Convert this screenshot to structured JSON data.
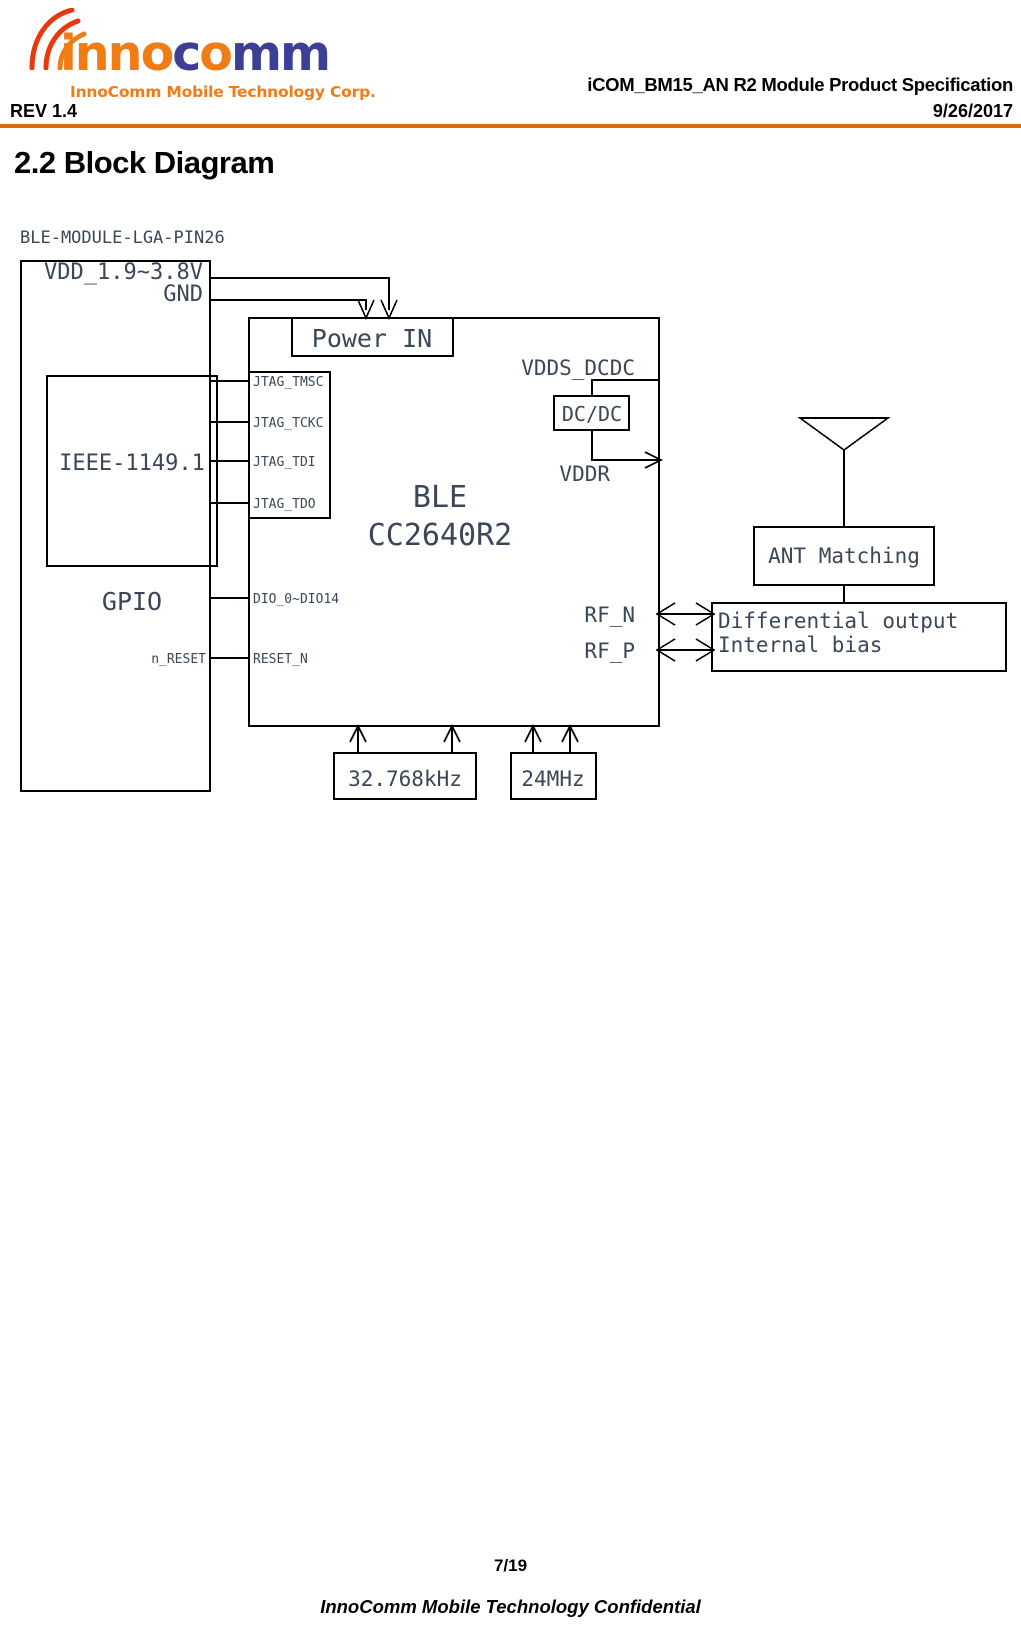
{
  "header": {
    "logo": {
      "wordmark_part1": "inno",
      "wordmark_part2": "c",
      "wordmark_part3": "o",
      "wordmark_part4": "mm",
      "tagline": "InnoComm Mobile Technology Corp.",
      "orange": "#F07C15",
      "blue": "#3B4095",
      "arc_color": "#E8380D"
    },
    "doc_title": "iCOM_BM15_AN R2 Module Product Specification",
    "revision": "REV 1.4",
    "date": "9/26/2017",
    "rule_color": "#E36C0A"
  },
  "section": {
    "heading": "2.2 Block Diagram"
  },
  "diagram": {
    "module_caption": "BLE-MODULE-LGA-PIN26",
    "module_labels": {
      "vdd": "VDD_1.9~3.8V",
      "gnd": "GND",
      "ieee": "IEEE-1149.1",
      "gpio": "GPIO",
      "n_reset": "n_RESET"
    },
    "chip": {
      "name_line1": "BLE",
      "name_line2": "CC2640R2",
      "power_in": "Power IN",
      "pins_left": [
        "JTAG_TMSC",
        "JTAG_TCKC",
        "JTAG_TDI",
        "JTAG_TDO",
        "DIO_0~DIO14",
        "RESET_N"
      ],
      "pins_right": [
        "VDDS_DCDC",
        "VDDR",
        "RF_N",
        "RF_P"
      ],
      "dcdc": "DC/DC"
    },
    "rf": {
      "ant_matching": "ANT Matching",
      "diff_line1": "Differential output",
      "diff_line2": "Internal bias"
    },
    "clocks": {
      "lf": "32.768kHz",
      "hf": "24MHz"
    }
  },
  "footer": {
    "page": "7/19",
    "confidential": "InnoComm Mobile Technology Confidential"
  }
}
